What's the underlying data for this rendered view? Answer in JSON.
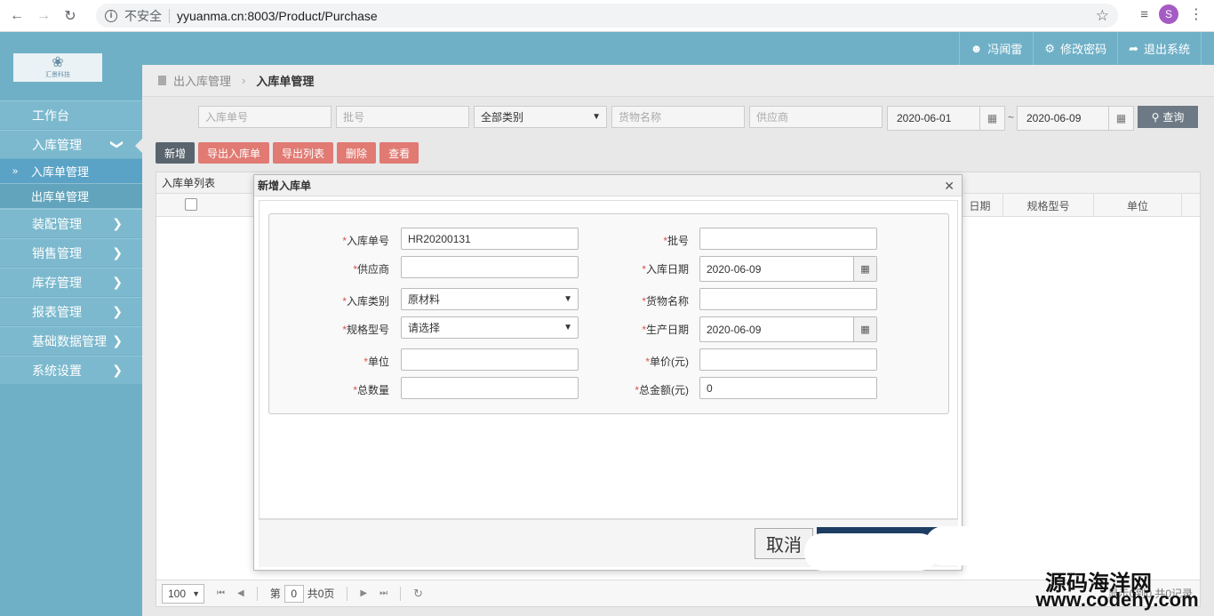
{
  "browser": {
    "security": "不安全",
    "url": "yyuanma.cn:8003/Product/Purchase",
    "profile_initial": "S"
  },
  "header": {
    "user": "冯闻雷",
    "change_password": "修改密码",
    "logout": "退出系统",
    "logo_text": "汇景科技"
  },
  "sidebar": {
    "items": [
      {
        "label": "工作台"
      },
      {
        "label": "入库管理"
      },
      {
        "label": "入库单管理"
      },
      {
        "label": "出库单管理"
      },
      {
        "label": "装配管理"
      },
      {
        "label": "销售管理"
      },
      {
        "label": "库存管理"
      },
      {
        "label": "报表管理"
      },
      {
        "label": "基础数据管理"
      },
      {
        "label": "系统设置"
      }
    ]
  },
  "breadcrumb": {
    "parent": "出入库管理",
    "current": "入库单管理"
  },
  "filters": {
    "order_no_placeholder": "入库单号",
    "batch_placeholder": "批号",
    "category": "全部类别",
    "goods_placeholder": "货物名称",
    "supplier_placeholder": "供应商",
    "date_from": "2020-06-01",
    "date_to": "2020-06-09",
    "tilde": "~",
    "query_label": "查询"
  },
  "toolbar": {
    "add": "新增",
    "export_order": "导出入库单",
    "export_list": "导出列表",
    "delete": "删除",
    "view": "查看"
  },
  "grid": {
    "title": "入库单列表",
    "columns": [
      "日期",
      "规格型号",
      "单位"
    ],
    "page_size": "100",
    "page_prefix": "第",
    "page_no": "0",
    "page_total": "共0页",
    "record_text": "显示0到0,共0记录"
  },
  "modal": {
    "title": "新增入库单",
    "fields": {
      "order_no": {
        "label": "入库单号",
        "value": "HR20200131"
      },
      "batch": {
        "label": "批号",
        "value": ""
      },
      "supplier": {
        "label": "供应商",
        "value": ""
      },
      "in_date": {
        "label": "入库日期",
        "value": "2020-06-09"
      },
      "category": {
        "label": "入库类别",
        "value": "原材料"
      },
      "goods": {
        "label": "货物名称",
        "value": ""
      },
      "spec": {
        "label": "规格型号",
        "value": "请选择"
      },
      "prod_date": {
        "label": "生产日期",
        "value": "2020-06-09"
      },
      "unit": {
        "label": "单位",
        "value": ""
      },
      "unit_price": {
        "label": "单价(元)",
        "value": ""
      },
      "quantity": {
        "label": "总数量",
        "value": ""
      },
      "total": {
        "label": "总金额(元)",
        "value": "0"
      }
    },
    "cancel": "取消"
  },
  "watermark": {
    "line1": "源码海洋网",
    "line2": "www.codehy.com"
  }
}
